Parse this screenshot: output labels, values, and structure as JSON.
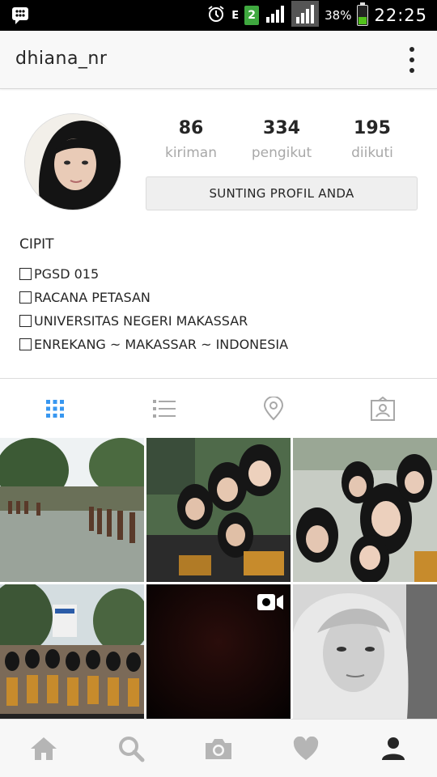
{
  "status_bar": {
    "network_type": "E",
    "sim_slot": "2",
    "battery_percent": "38%",
    "battery_level": 0.38,
    "time": "22:25",
    "icons": [
      "bbm-icon",
      "alarm-icon",
      "signal-icon",
      "battery-icon"
    ]
  },
  "header": {
    "username": "dhiana_nr",
    "menu_icon": "more-vertical-icon"
  },
  "profile": {
    "stats": [
      {
        "value": "86",
        "label": "kiriman"
      },
      {
        "value": "334",
        "label": "pengikut"
      },
      {
        "value": "195",
        "label": "diikuti"
      }
    ],
    "edit_button": "SUNTING PROFIL ANDA",
    "bio_name": "CIPIT",
    "bio_lines": [
      "PGSD 015",
      "RACANA PETASAN",
      "UNIVERSITAS NEGERI MAKASSAR",
      "ENREKANG ~ MAKASSAR ~ INDONESIA"
    ]
  },
  "tabs": [
    {
      "icon": "grid-icon",
      "active": true
    },
    {
      "icon": "list-icon",
      "active": false
    },
    {
      "icon": "location-pin-icon",
      "active": false
    },
    {
      "icon": "tagged-photos-icon",
      "active": false
    }
  ],
  "grid_posts": [
    {
      "kind": "photo",
      "description_icon": "photo-thumbnail"
    },
    {
      "kind": "photo",
      "description_icon": "photo-thumbnail"
    },
    {
      "kind": "photo",
      "description_icon": "photo-thumbnail"
    },
    {
      "kind": "photo",
      "description_icon": "photo-thumbnail"
    },
    {
      "kind": "video",
      "description_icon": "video-camera-icon"
    },
    {
      "kind": "photo",
      "description_icon": "photo-thumbnail"
    }
  ],
  "bottom_nav": [
    {
      "icon": "home-icon"
    },
    {
      "icon": "search-icon"
    },
    {
      "icon": "camera-icon"
    },
    {
      "icon": "heart-icon"
    },
    {
      "icon": "profile-icon",
      "active": true
    }
  ],
  "colors": {
    "accent_blue": "#3897f0",
    "icon_gray": "#a8a8a8",
    "text_dark": "#262626",
    "muted_label": "#a8a8a8"
  }
}
